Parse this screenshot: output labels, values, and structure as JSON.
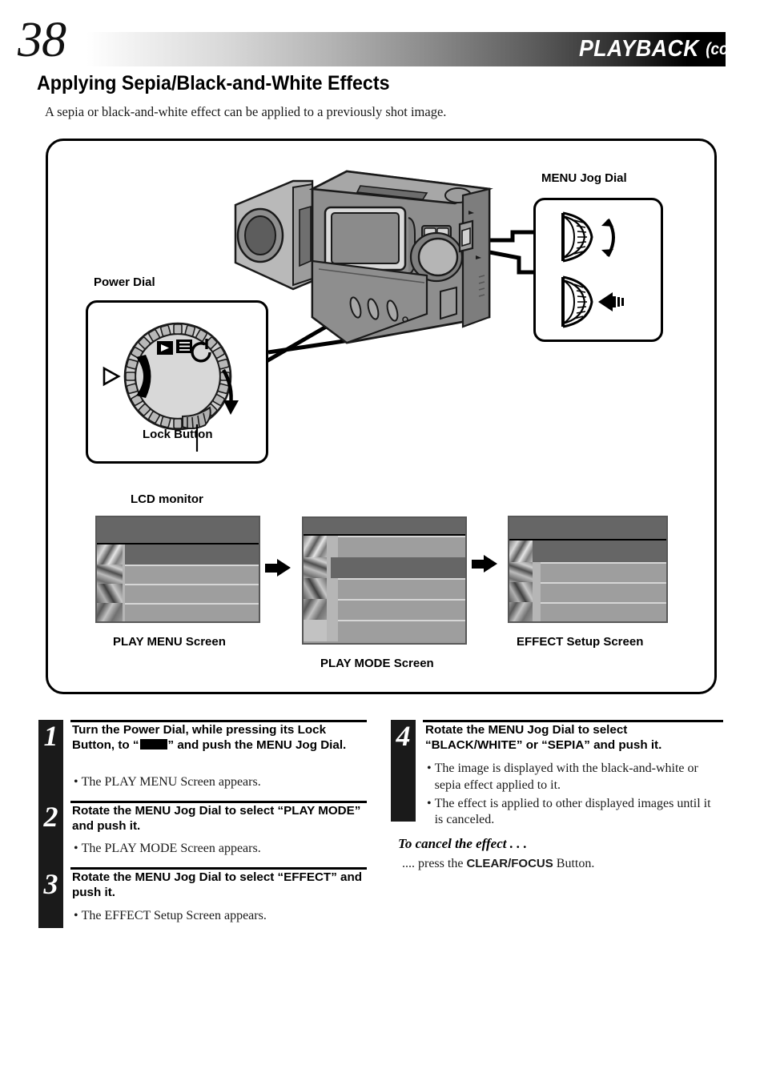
{
  "header": {
    "page_number": "38",
    "title_main": "PLAYBACK",
    "title_cont": "(cont.)"
  },
  "section": {
    "title": "Applying Sepia/Black-and-White Effects",
    "subtitle": "A sepia or black-and-white effect can be applied to a previously shot image."
  },
  "diagram": {
    "jog_dial_label": "MENU Jog Dial",
    "power_dial_label": "Power Dial",
    "lock_button_label": "Lock Button",
    "lcd_monitor_label": "LCD monitor",
    "captions": {
      "play_menu": "PLAY MENU Screen",
      "play_mode": "PLAY MODE Screen",
      "effect_setup": "EFFECT Setup Screen"
    },
    "jog_dial_actions": [
      "rotate-dial-icon",
      "push-dial-icon"
    ],
    "power_dial_icons": [
      "play-icon",
      "menu-icon",
      "power-icon"
    ],
    "screens": [
      {
        "name": "PLAY MENU Screen",
        "rows": 4,
        "selected_index": 0
      },
      {
        "name": "PLAY MODE Screen",
        "rows": 5,
        "selected_index": 1
      },
      {
        "name": "EFFECT Setup Screen",
        "rows": 4,
        "selected_index": 0
      }
    ]
  },
  "steps": [
    {
      "number": "1",
      "head_part1": "Turn the Power Dial, while pressing its Lock Button, to “",
      "head_chip": "black-mode-chip",
      "head_part2": "” and push the MENU Jog Dial.",
      "bullets": [
        "The PLAY MENU Screen appears."
      ]
    },
    {
      "number": "2",
      "head": "Rotate the MENU Jog Dial to select “PLAY MODE” and push it.",
      "bullets": [
        "The PLAY MODE Screen appears."
      ]
    },
    {
      "number": "3",
      "head": "Rotate the MENU Jog Dial to select “EFFECT” and push it.",
      "bullets": [
        "The EFFECT Setup Screen appears."
      ]
    },
    {
      "number": "4",
      "head": "Rotate the MENU Jog Dial to select “BLACK/WHITE” or “SEPIA” and push it.",
      "bullets": [
        "The image is displayed with the black-and-white or sepia effect applied to it.",
        "The effect is applied to other displayed images until it is canceled."
      ]
    }
  ],
  "cancel_note": {
    "title": "To cancel the effect . . .",
    "prefix": ".... press the ",
    "emphasis": "CLEAR/FOCUS",
    "suffix": " Button."
  },
  "colors": {
    "ink": "#000000",
    "lcd_header": "#666666",
    "lcd_selected": "#666666",
    "lcd_row": "#9e9e9e",
    "camera_body": "#8e8e8e"
  }
}
